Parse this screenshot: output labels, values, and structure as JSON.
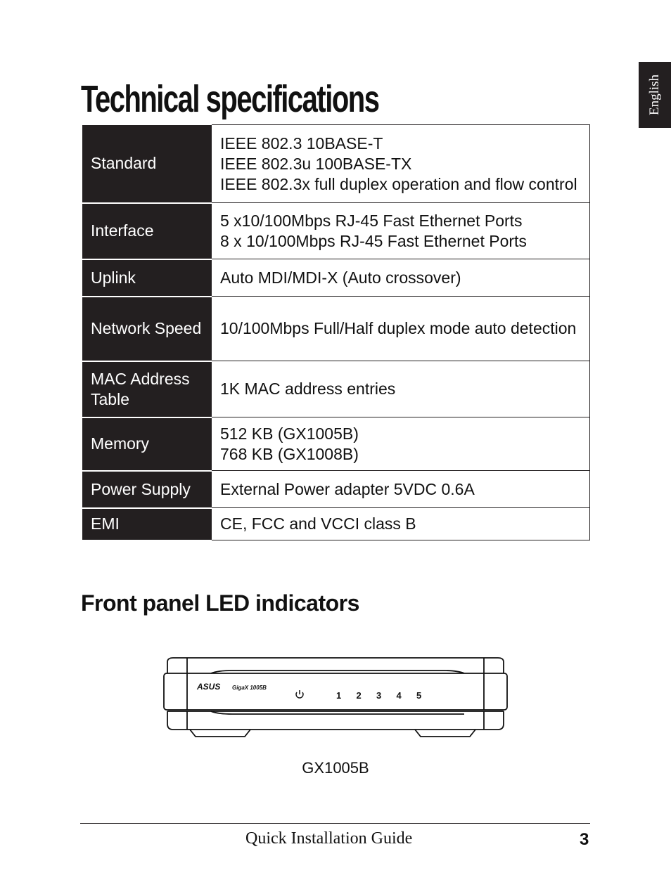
{
  "side_tab": {
    "label": "English"
  },
  "title": "Technical specifications",
  "spec_table": [
    {
      "key": "Standard",
      "values": [
        "IEEE 802.3 10BASE-T",
        "IEEE 802.3u 100BASE-TX",
        "IEEE 802.3x full duplex operation and flow control"
      ]
    },
    {
      "key": "Interface",
      "values": [
        "5 x10/100Mbps RJ-45 Fast Ethernet Ports",
        "8 x 10/100Mbps RJ-45 Fast Ethernet Ports"
      ]
    },
    {
      "key": "Uplink",
      "values": [
        "Auto MDI/MDI-X (Auto crossover)"
      ]
    },
    {
      "key": "Network Speed",
      "values": [
        "10/100Mbps Full/Half duplex mode auto detection"
      ]
    },
    {
      "key": "MAC Address Table",
      "values": [
        "1K MAC address entries"
      ]
    },
    {
      "key": "Memory",
      "values": [
        "512 KB (GX1005B)",
        "768 KB (GX1008B)"
      ]
    },
    {
      "key": "Power Supply",
      "values": [
        "External Power adapter 5VDC 0.6A"
      ]
    },
    {
      "key": "EMI",
      "values": [
        "CE, FCC and VCCI class B"
      ]
    }
  ],
  "led_section": {
    "heading": "Front panel LED indicators",
    "device": {
      "brand": "ASUS",
      "model_logo": "GigaX 1005B",
      "led_labels": [
        "1",
        "2",
        "3",
        "4",
        "5"
      ],
      "power_icon": "power-icon"
    },
    "caption": "GX1005B"
  },
  "footer": {
    "guide_title": "Quick Installation Guide",
    "page_number": "3"
  }
}
